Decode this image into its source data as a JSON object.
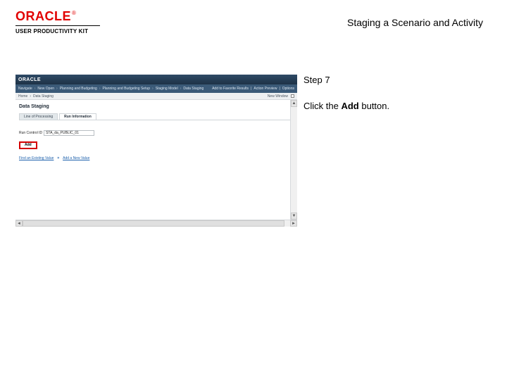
{
  "header": {
    "brand": "ORACLE",
    "registered": "®",
    "subtitle": "USER PRODUCTIVITY KIT",
    "page_title": "Staging a Scenario and Activity"
  },
  "instruction": {
    "step_label": "Step 7",
    "body_prefix": "Click the ",
    "body_bold": "Add",
    "body_suffix": " button."
  },
  "shot": {
    "brand": "ORACLE",
    "nav": {
      "items": [
        "Navigate",
        "New Open",
        "Planning and Budgeting",
        "Planning and Budgeting Setup",
        "Staging Model",
        "Data Staging"
      ],
      "sep": "›",
      "right": [
        "Add to Favorite Results",
        "Action Preview",
        "Options"
      ],
      "pipe": "|"
    },
    "crumbs": {
      "items": [
        "Home",
        "Data Staging"
      ],
      "sep": "›",
      "new_window": "New Window",
      "cb_title": "checkbox"
    },
    "section_title": "Data Staging",
    "tabs": [
      "Line of Processing",
      "Run Information"
    ],
    "active_tab": 1,
    "run_label": "Run Control ID",
    "run_value": "STA_da_PUBLIC_01",
    "add_label": "Add",
    "links": {
      "existing": "Find an Existing Value",
      "star": "✶",
      "addnew": "Add a New Value"
    },
    "arrows": {
      "left": "◄",
      "right": "►",
      "up": "▲",
      "down": "▼"
    }
  }
}
